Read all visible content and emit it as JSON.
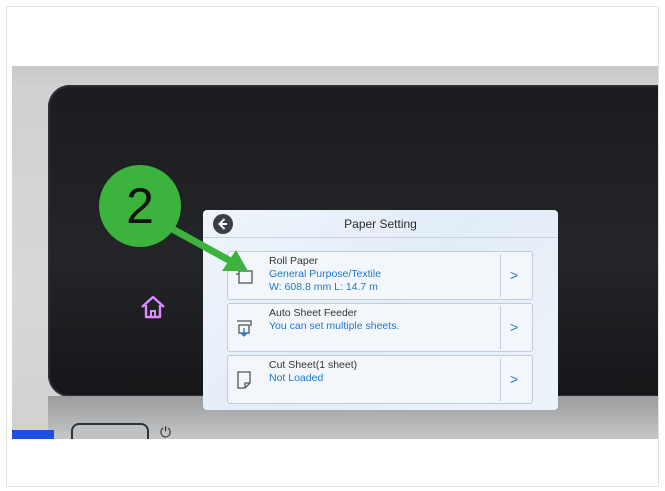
{
  "step_number": "2",
  "home_icon": "home-icon",
  "screen": {
    "title": "Paper Setting",
    "back_icon": "back-arrow-icon",
    "rows": [
      {
        "icon": "roll-paper-icon",
        "title": "Roll Paper",
        "line1": "General Purpose/Textile",
        "line2": "W: 608.8 mm L: 14.7 m",
        "chevron": ">"
      },
      {
        "icon": "sheet-feeder-icon",
        "title": "Auto Sheet Feeder",
        "line1": "You can set multiple sheets.",
        "line2": "",
        "chevron": ">"
      },
      {
        "icon": "cut-sheet-icon",
        "title": "Cut Sheet(1 sheet)",
        "line1": "Not Loaded",
        "line2": "",
        "chevron": ">"
      }
    ]
  },
  "colors": {
    "step_badge": "#3cb33d",
    "accent_text": "#1d78d2",
    "home_icon": "#d78cff",
    "indicator_led": "#1f4fe0"
  }
}
